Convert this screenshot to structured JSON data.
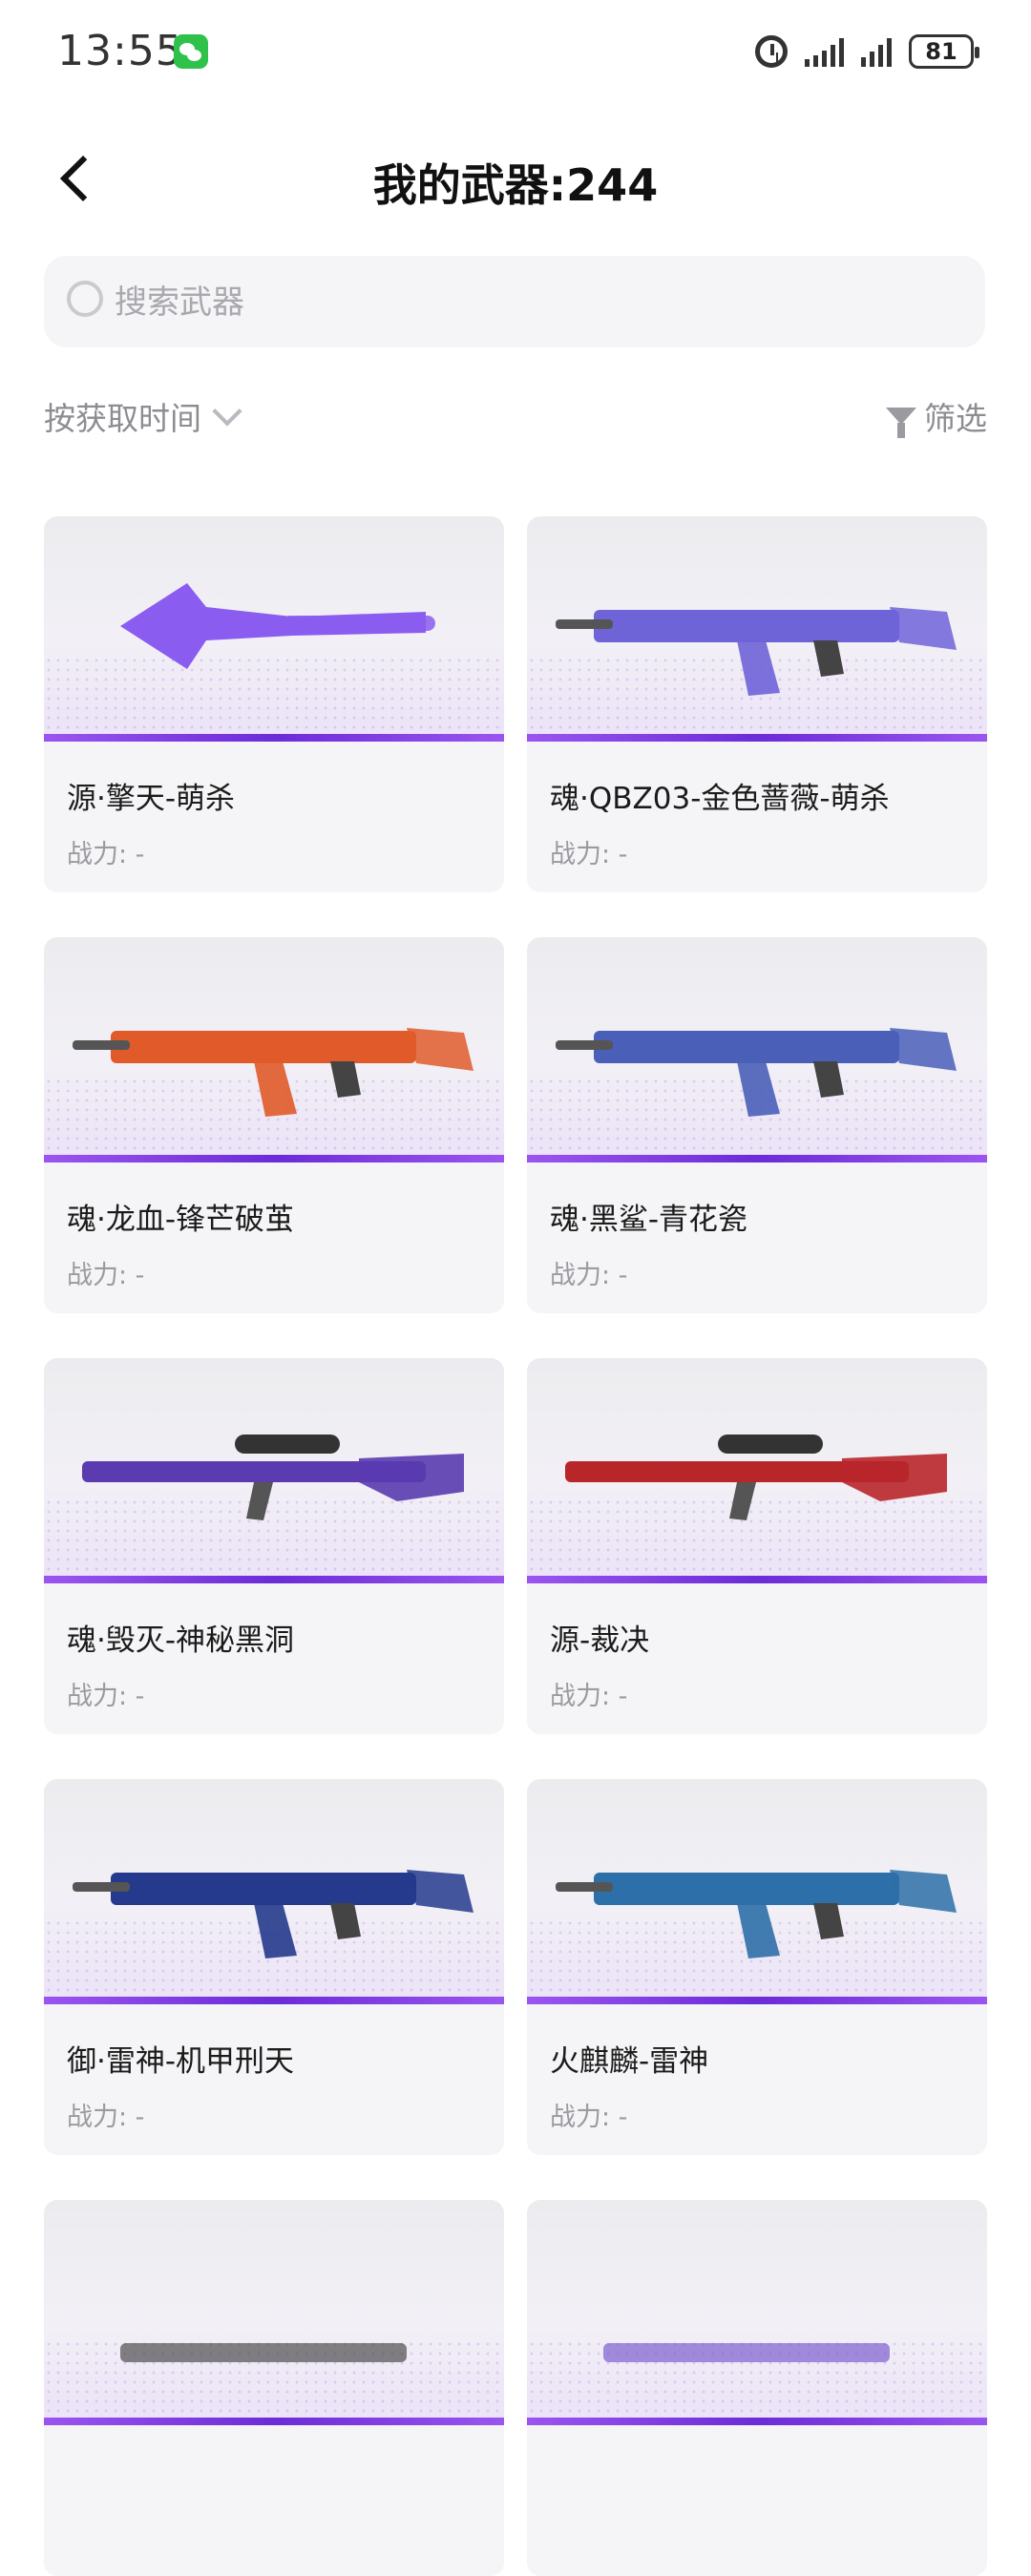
{
  "status_bar": {
    "time": "13:55",
    "battery": "81"
  },
  "header": {
    "title": "我的武器:244"
  },
  "search": {
    "placeholder": "搜索武器"
  },
  "toolbar": {
    "sort_label": "按获取时间",
    "filter_label": "筛选"
  },
  "weapons": [
    {
      "name": "源·擎天-萌杀",
      "power": "战力: -",
      "icon": "axe-weapon-icon",
      "color": "#8a5cf0"
    },
    {
      "name": "魂·QBZ03-金色蔷薇-萌杀",
      "power": "战力: -",
      "icon": "rifle-weapon-icon",
      "color": "#6f63d8"
    },
    {
      "name": "魂·龙血-锋芒破茧",
      "power": "战力: -",
      "icon": "rifle-weapon-icon",
      "color": "#e05a2a"
    },
    {
      "name": "魂·黑鲨-青花瓷",
      "power": "战力: -",
      "icon": "rifle-weapon-icon",
      "color": "#4a5fb8"
    },
    {
      "name": "魂·毁灭-神秘黑洞",
      "power": "战力: -",
      "icon": "sniper-weapon-icon",
      "color": "#5a3bb0"
    },
    {
      "name": "源-裁决",
      "power": "战力: -",
      "icon": "sniper-weapon-icon",
      "color": "#b8262a"
    },
    {
      "name": "御·雷神-机甲刑天",
      "power": "战力: -",
      "icon": "rifle-weapon-icon",
      "color": "#253a8c"
    },
    {
      "name": "火麒麟-雷神",
      "power": "战力: -",
      "icon": "rifle-weapon-icon",
      "color": "#2d6fa8"
    },
    {
      "name": "",
      "power": "",
      "icon": "weapon-icon",
      "color": "#333333"
    },
    {
      "name": "",
      "power": "",
      "icon": "weapon-icon",
      "color": "#6a48c8"
    }
  ]
}
